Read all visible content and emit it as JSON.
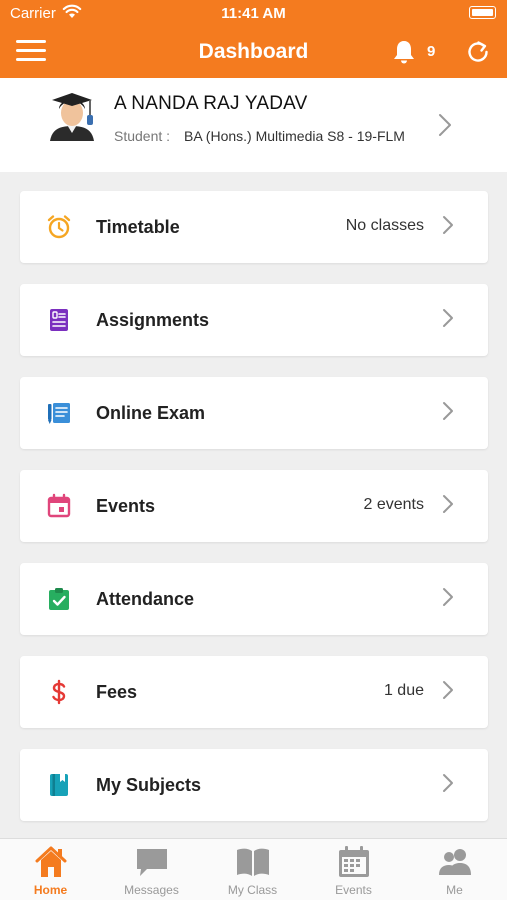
{
  "status_bar": {
    "carrier": "Carrier",
    "time": "11:41 AM"
  },
  "nav": {
    "title": "Dashboard",
    "notification_count": "9"
  },
  "profile": {
    "name": "A NANDA RAJ YADAV",
    "role_label": "Student :",
    "course": "BA (Hons.) Multimedia S8 - 19-FLM"
  },
  "menu": [
    {
      "label": "Timetable",
      "value": "No classes",
      "icon": "alarm-clock-icon",
      "color": "#f5a623"
    },
    {
      "label": "Assignments",
      "value": "",
      "icon": "assignment-icon",
      "color": "#7b2fbf"
    },
    {
      "label": "Online Exam",
      "value": "",
      "icon": "online-exam-icon",
      "color": "#3a8fd9"
    },
    {
      "label": "Events",
      "value": "2 events",
      "icon": "calendar-icon",
      "color": "#e0457b"
    },
    {
      "label": "Attendance",
      "value": "",
      "icon": "clipboard-check-icon",
      "color": "#27ae60"
    },
    {
      "label": "Fees",
      "value": "1 due",
      "icon": "dollar-icon",
      "color": "#e53935"
    },
    {
      "label": "My Subjects",
      "value": "",
      "icon": "book-icon",
      "color": "#17a2b8"
    }
  ],
  "tabs": [
    {
      "label": "Home",
      "icon": "home-icon",
      "active": true
    },
    {
      "label": "Messages",
      "icon": "messages-icon",
      "active": false
    },
    {
      "label": "My Class",
      "icon": "open-book-icon",
      "active": false
    },
    {
      "label": "Events",
      "icon": "calendar-icon",
      "active": false
    },
    {
      "label": "Me",
      "icon": "people-icon",
      "active": false
    }
  ],
  "colors": {
    "brand": "#f47b1f",
    "tab_inactive": "#999999",
    "background": "#efefef"
  }
}
